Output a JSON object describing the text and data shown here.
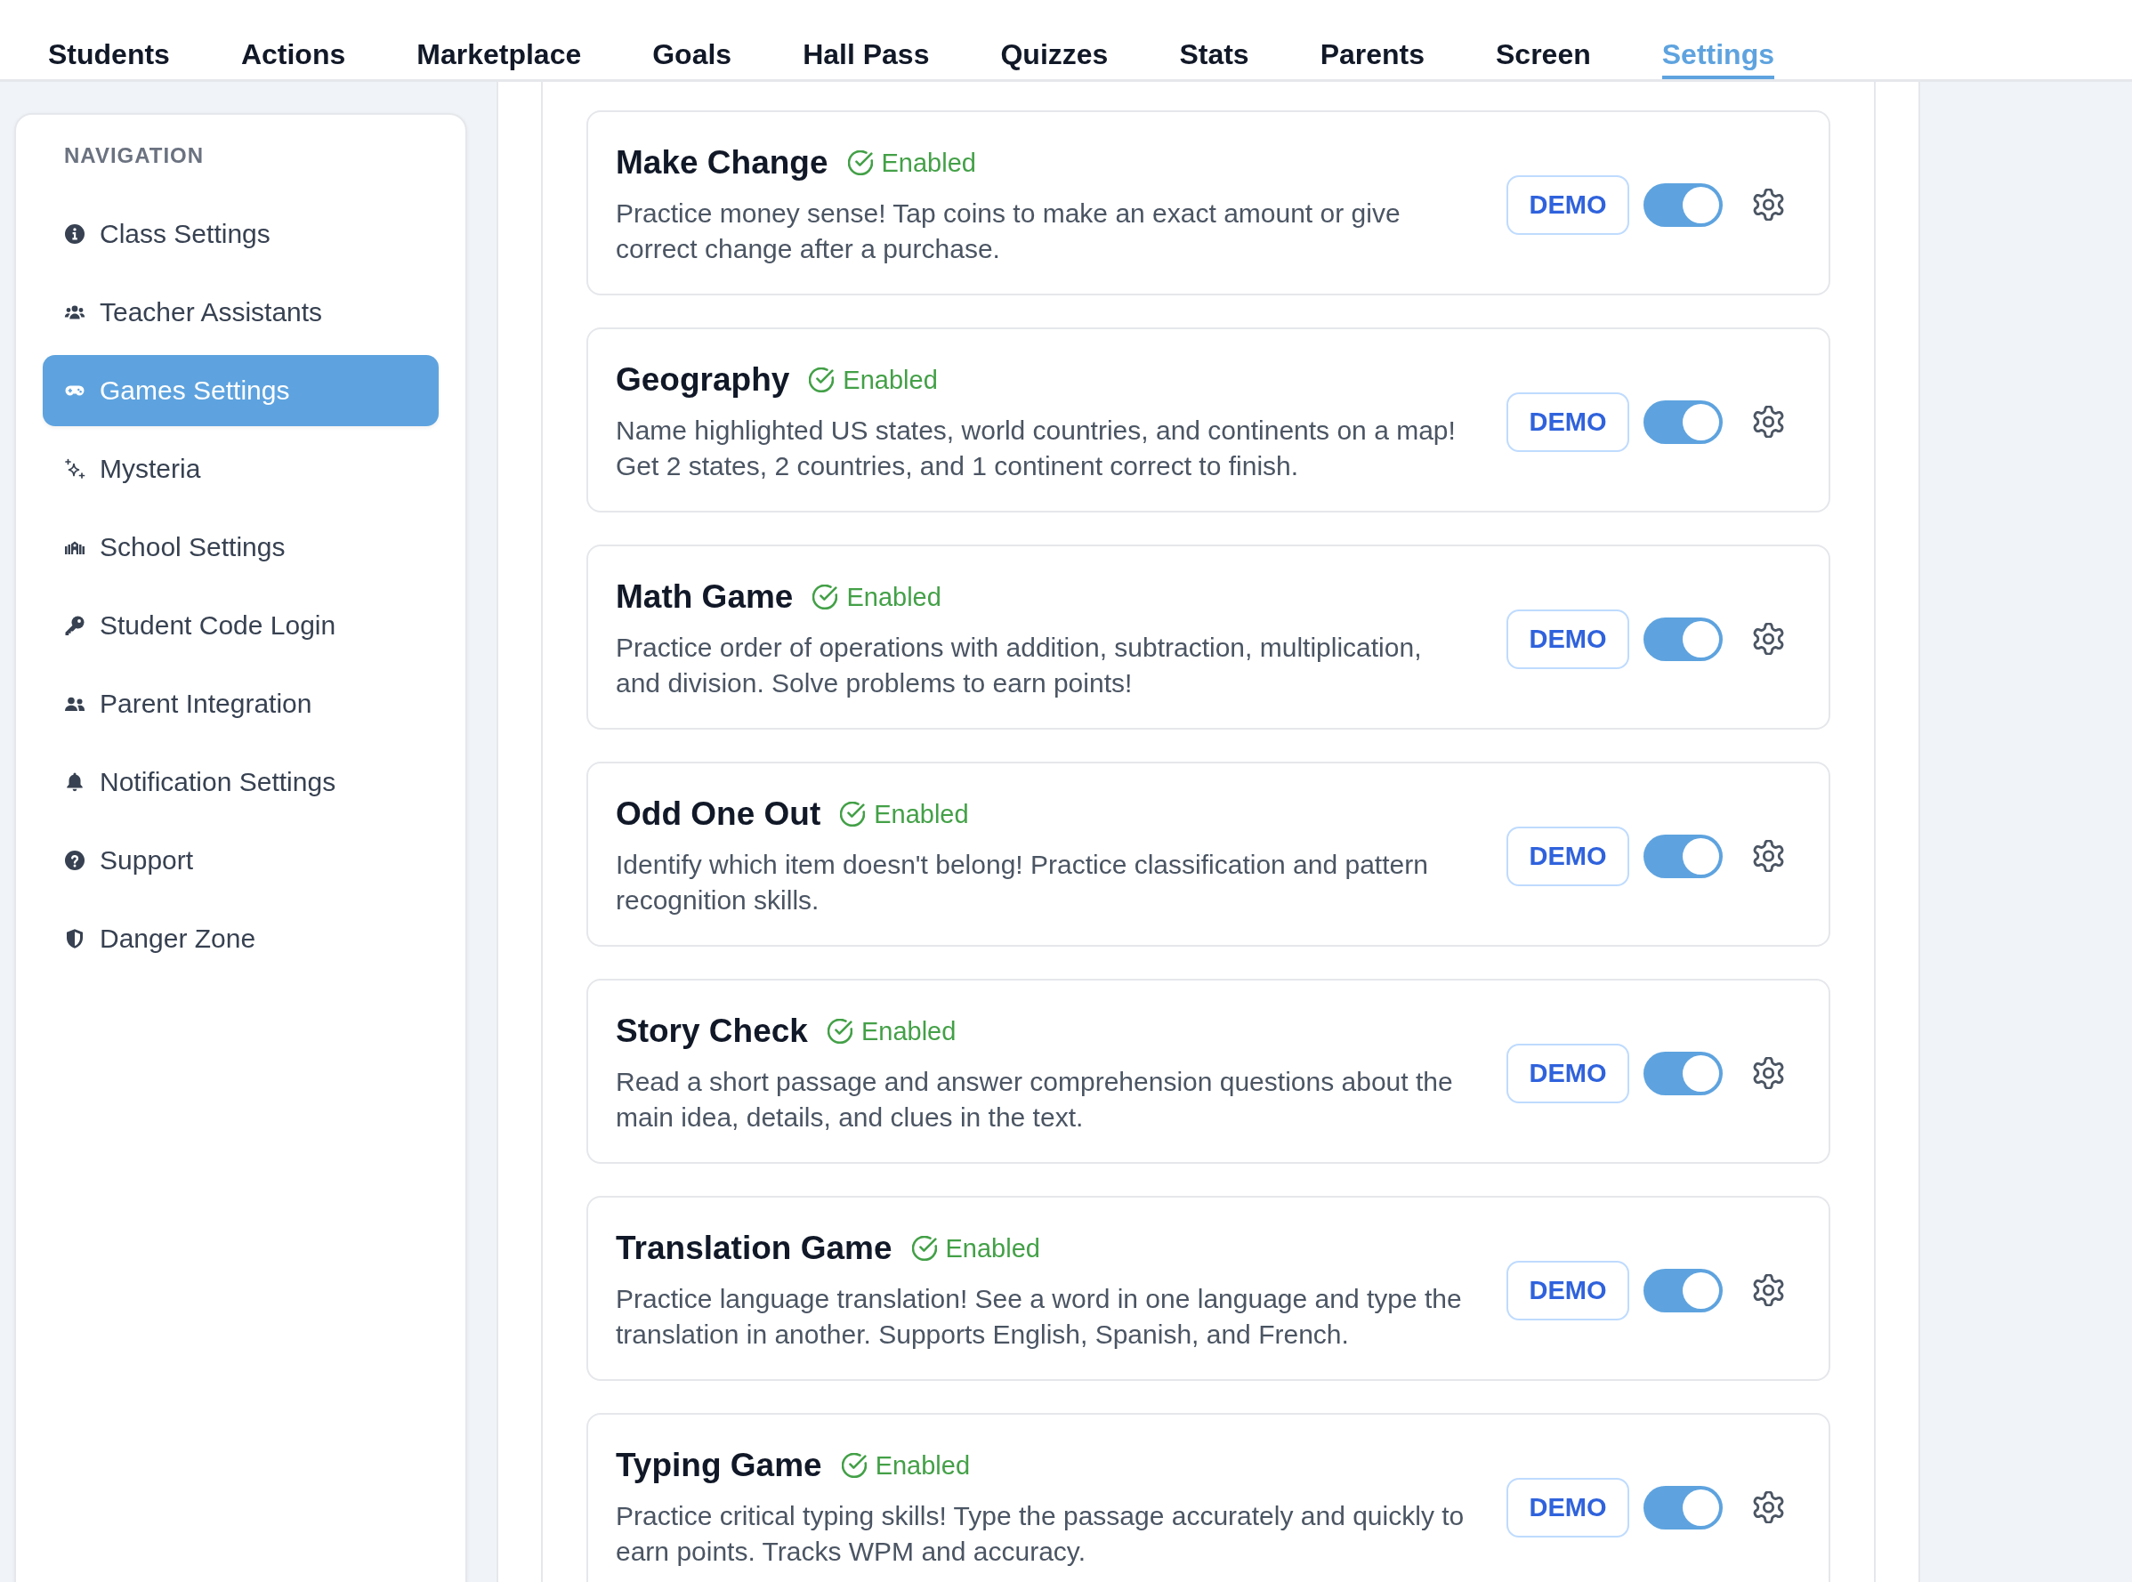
{
  "tabs": [
    {
      "label": "Students",
      "selected": false
    },
    {
      "label": "Actions",
      "selected": false
    },
    {
      "label": "Marketplace",
      "selected": false
    },
    {
      "label": "Goals",
      "selected": false
    },
    {
      "label": "Hall Pass",
      "selected": false
    },
    {
      "label": "Quizzes",
      "selected": false
    },
    {
      "label": "Stats",
      "selected": false
    },
    {
      "label": "Parents",
      "selected": false
    },
    {
      "label": "Screen",
      "selected": false
    },
    {
      "label": "Settings",
      "selected": true
    }
  ],
  "sidebar": {
    "heading": "NAVIGATION",
    "items": [
      {
        "label": "Class Settings",
        "selected": false
      },
      {
        "label": "Teacher Assistants",
        "selected": false
      },
      {
        "label": "Games Settings",
        "selected": true
      },
      {
        "label": "Mysteria",
        "selected": false
      },
      {
        "label": "School Settings",
        "selected": false
      },
      {
        "label": "Student Code Login",
        "selected": false
      },
      {
        "label": "Parent Integration",
        "selected": false
      },
      {
        "label": "Notification Settings",
        "selected": false
      },
      {
        "label": "Support",
        "selected": false
      },
      {
        "label": "Danger Zone",
        "selected": false
      }
    ]
  },
  "games": [
    {
      "title": "Make Change",
      "status": "Enabled",
      "description": "Practice money sense! Tap coins to make an exact amount or give correct change after a purchase.",
      "demo_label": "DEMO",
      "on": true
    },
    {
      "title": "Geography",
      "status": "Enabled",
      "description": "Name highlighted US states, world countries, and continents on a map! Get 2 states, 2 countries, and 1 continent correct to finish.",
      "demo_label": "DEMO",
      "on": true
    },
    {
      "title": "Math Game",
      "status": "Enabled",
      "description": "Practice order of operations with addition, subtraction, multiplication, and division. Solve problems to earn points!",
      "demo_label": "DEMO",
      "on": true
    },
    {
      "title": "Odd One Out",
      "status": "Enabled",
      "description": "Identify which item doesn't belong! Practice classification and pattern recognition skills.",
      "demo_label": "DEMO",
      "on": true
    },
    {
      "title": "Story Check",
      "status": "Enabled",
      "description": "Read a short passage and answer comprehension questions about the main idea, details, and clues in the text.",
      "demo_label": "DEMO",
      "on": true
    },
    {
      "title": "Translation Game",
      "status": "Enabled",
      "description": "Practice language translation! See a word in one language and type the translation in another. Supports English, Spanish, and French.",
      "demo_label": "DEMO",
      "on": true
    },
    {
      "title": "Typing Game",
      "status": "Enabled",
      "description": "Practice critical typing skills! Type the passage accurately and quickly to earn points. Tracks WPM and accuracy.",
      "demo_label": "DEMO",
      "on": true
    }
  ]
}
